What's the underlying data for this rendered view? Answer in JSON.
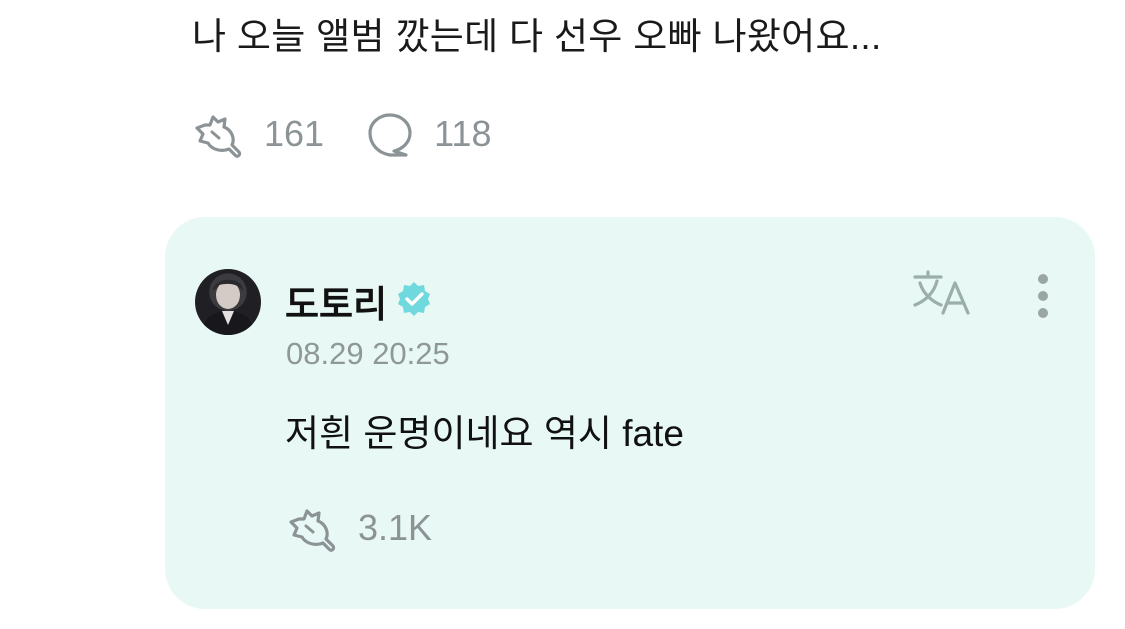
{
  "post": {
    "text": "나 오늘 앨범 깠는데 다 선우 오빠 나왔어요...",
    "like_count": "161",
    "comment_count": "118"
  },
  "reply": {
    "author": "도토리",
    "timestamp": "08.29 20:25",
    "text": "저흰 운명이네요 역시 fate",
    "like_count": "3.1K"
  },
  "icons": {
    "like": "clapping-hand-icon",
    "comment": "speech-bubble-icon",
    "verified": "verified-badge-icon",
    "translate": "translate-icon",
    "more": "more-vertical-icon"
  },
  "colors": {
    "card_background": "#e8f9f5",
    "verified_badge": "#6fd9dd",
    "muted_text": "#8c9396"
  }
}
